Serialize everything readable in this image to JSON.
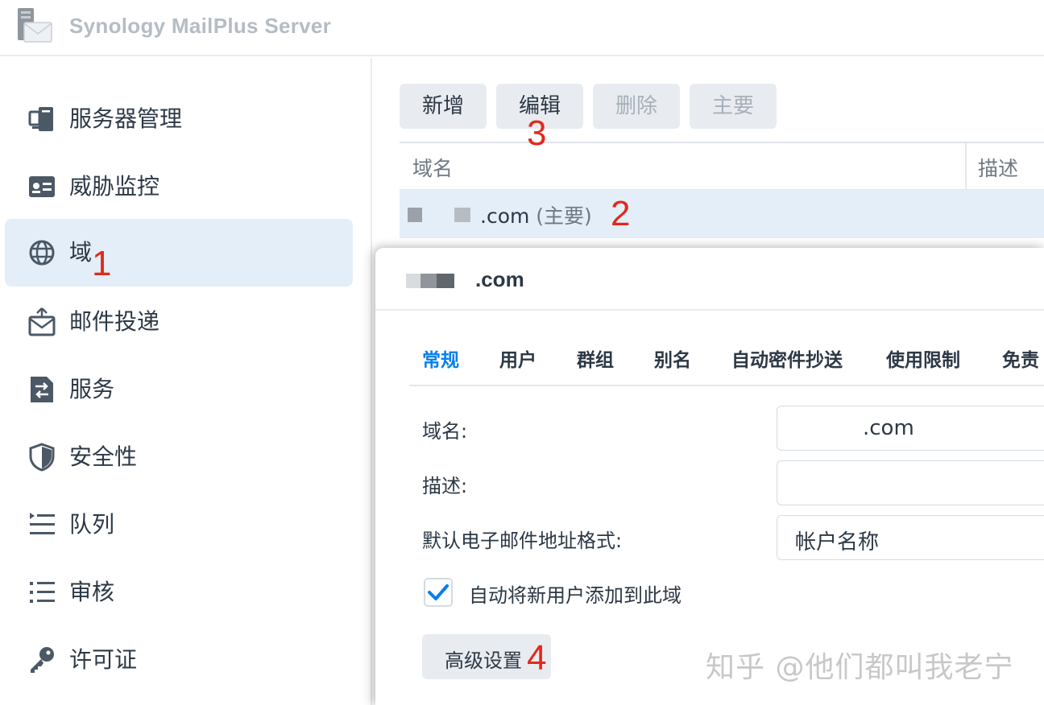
{
  "app": {
    "title": "Synology MailPlus Server"
  },
  "sidebar": {
    "items": [
      {
        "label": "服务器管理",
        "icon": "server-management-icon"
      },
      {
        "label": "威胁监控",
        "icon": "threat-monitor-icon"
      },
      {
        "label": "域",
        "icon": "globe-icon",
        "active": true
      },
      {
        "label": "邮件投递",
        "icon": "mail-delivery-icon"
      },
      {
        "label": "服务",
        "icon": "service-icon"
      },
      {
        "label": "安全性",
        "icon": "shield-icon"
      },
      {
        "label": "队列",
        "icon": "queue-icon"
      },
      {
        "label": "审核",
        "icon": "audit-icon"
      },
      {
        "label": "许可证",
        "icon": "key-icon"
      }
    ]
  },
  "toolbar": {
    "add": "新增",
    "edit": "编辑",
    "delete": "删除",
    "primary": "主要"
  },
  "grid": {
    "columns": [
      "域名",
      "描述"
    ],
    "rows": [
      {
        "domain": ".com",
        "tag": "(主要)"
      }
    ]
  },
  "callouts": {
    "one": "1",
    "two": "2",
    "three": "3",
    "four": "4"
  },
  "dialog": {
    "title": ".com",
    "tabs": [
      "常规",
      "用户",
      "群组",
      "别名",
      "自动密件抄送",
      "使用限制",
      "免责"
    ],
    "active_tab": "常规",
    "form": {
      "domain_label": "域名:",
      "domain_value": ".com",
      "desc_label": "描述:",
      "desc_value": "",
      "format_label": "默认电子邮件地址格式:",
      "format_value": "帐户名称",
      "auto_add_label": "自动将新用户添加到此域",
      "auto_add_checked": true,
      "advanced_button": "高级设置"
    }
  },
  "watermark": "知乎 @他们都叫我老宁",
  "colors": {
    "accent": "#057feb",
    "callout": "#e2291c",
    "selection": "#e4eef9"
  }
}
